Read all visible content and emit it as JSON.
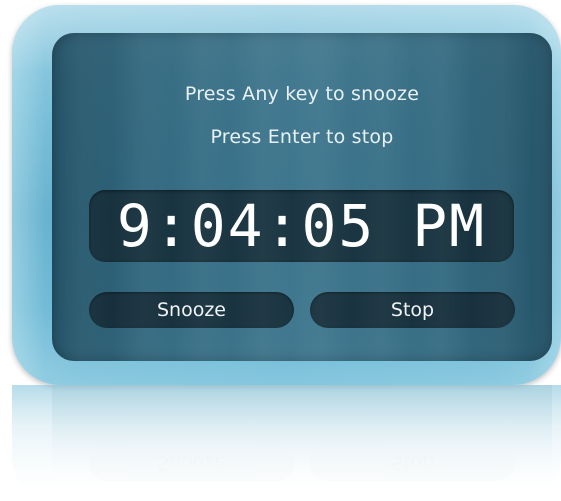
{
  "alarm": {
    "instruction_snooze": "Press Any key to snooze",
    "instruction_stop": "Press Enter to stop",
    "time": "9:04:05 PM",
    "snooze_label": "Snooze",
    "stop_label": "Stop"
  },
  "colors": {
    "card_outer": "#6ab6d3",
    "panel": "#2e6278",
    "control_bg": "#142832",
    "text": "#ffffff"
  }
}
